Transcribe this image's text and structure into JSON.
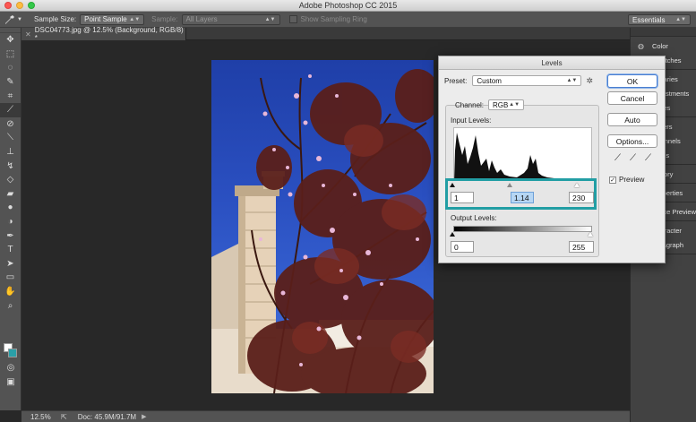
{
  "window": {
    "title": "Adobe Photoshop CC 2015"
  },
  "options_bar": {
    "tool_icon": "eyedropper-icon",
    "sample_size_label": "Sample Size:",
    "sample_size_value": "Point Sample",
    "sample_label": "Sample:",
    "sample_value": "All Layers",
    "show_ring_label": "Show Sampling Ring",
    "workspace": "Essentials"
  },
  "document_tab": {
    "title": "DSC04773.jpg @ 12.5% (Background, RGB/8) *"
  },
  "toolbar": {
    "tools": [
      "move",
      "marquee",
      "lasso",
      "quick-select",
      "crop",
      "eyedropper",
      "healing",
      "brush",
      "stamp",
      "history-brush",
      "eraser",
      "gradient",
      "blur",
      "dodge",
      "pen",
      "type",
      "path-select",
      "shape",
      "hand",
      "zoom"
    ]
  },
  "status_bar": {
    "zoom": "12.5%",
    "doc": "Doc: 45.9M/91.7M"
  },
  "dock": {
    "items": [
      {
        "label": "Color",
        "icon": "color-icon"
      },
      {
        "label": "Swatches",
        "icon": "swatches-icon"
      },
      {
        "label": "Libraries",
        "icon": "libraries-icon"
      },
      {
        "label": "Adjustments",
        "icon": "adjustments-icon"
      },
      {
        "label": "Styles",
        "icon": "styles-icon"
      },
      {
        "label": "Layers",
        "icon": "layers-icon"
      },
      {
        "label": "Channels",
        "icon": "channels-icon"
      },
      {
        "label": "Paths",
        "icon": "paths-icon"
      },
      {
        "label": "History",
        "icon": "history-icon"
      },
      {
        "label": "Properties",
        "icon": "properties-icon"
      },
      {
        "label": "Device Preview",
        "icon": "device-preview-icon"
      },
      {
        "label": "Character",
        "icon": "character-icon"
      },
      {
        "label": "Paragraph",
        "icon": "paragraph-icon"
      }
    ]
  },
  "levels": {
    "title": "Levels",
    "preset_label": "Preset:",
    "preset_value": "Custom",
    "channel_label": "Channel:",
    "channel_value": "RGB",
    "input_label": "Input Levels:",
    "input_black": "1",
    "input_gamma": "1.14",
    "input_white": "230",
    "output_label": "Output Levels:",
    "output_black": "0",
    "output_white": "255",
    "buttons": {
      "ok": "OK",
      "cancel": "Cancel",
      "auto": "Auto",
      "options": "Options..."
    },
    "preview_label": "Preview",
    "preview_checked": true
  },
  "colors": {
    "highlight": "#229ea4",
    "foreground": "#ffffff",
    "background": "#2a9fa8"
  }
}
